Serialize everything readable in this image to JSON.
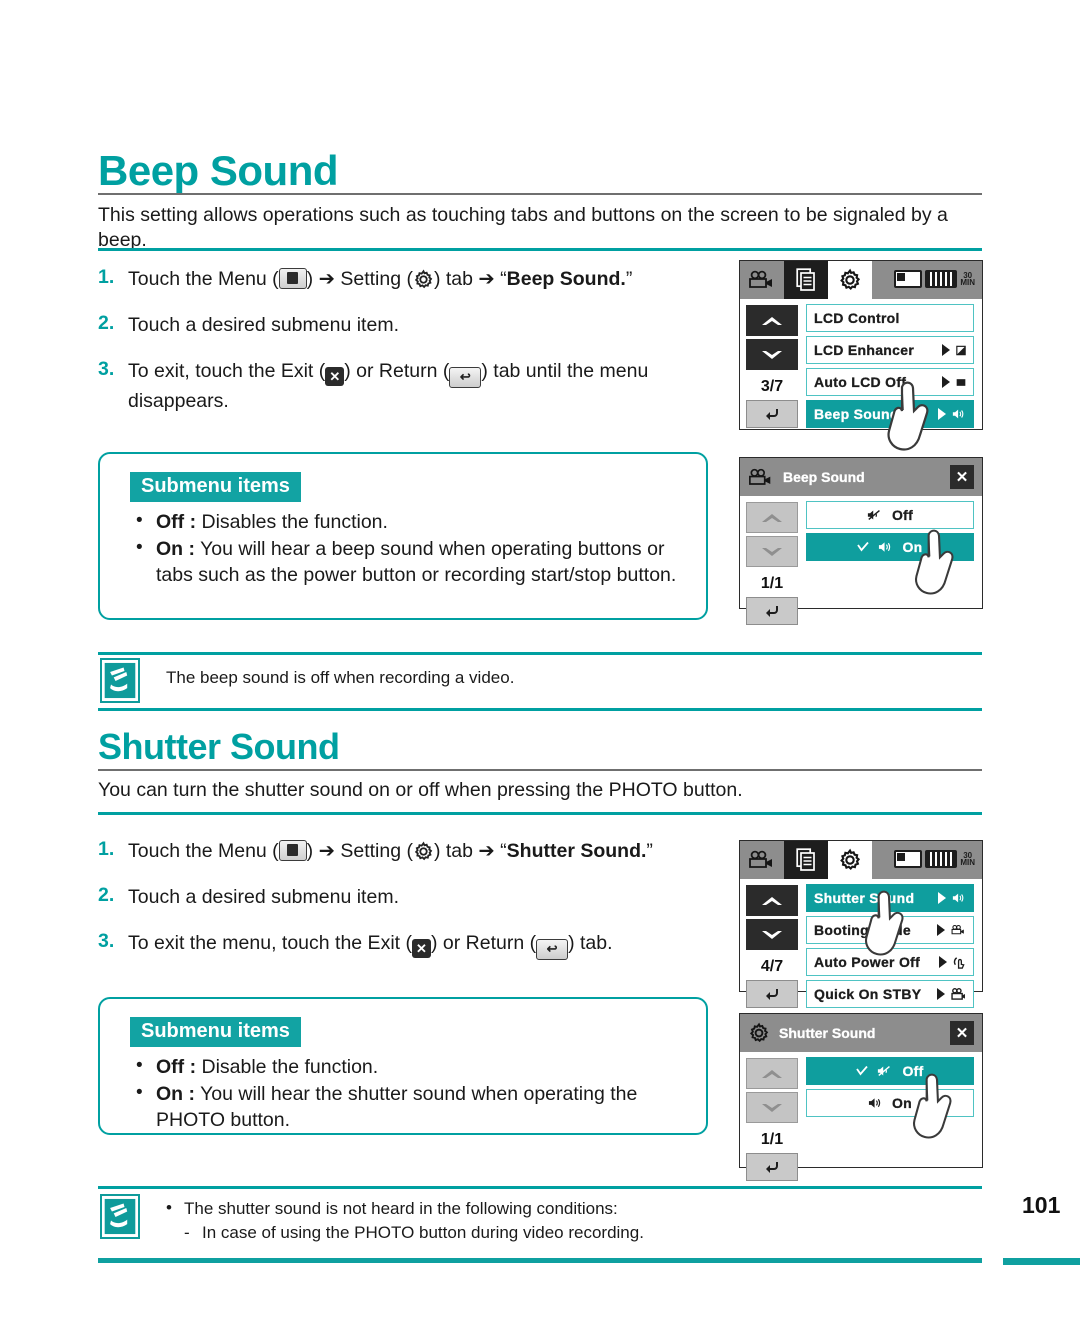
{
  "page": {
    "number": "101"
  },
  "sections": [
    {
      "id": "beep",
      "title": "Beep Sound",
      "description": "This setting allows operations such as touching tabs and buttons on the screen to be signaled by a beep.",
      "steps": [
        {
          "num": "1.",
          "pre": "Touch the Menu (",
          "mid": ") ➔ Setting (",
          "mid2": ") tab ➔ “",
          "bold": "Beep Sound.",
          "post": "”"
        },
        {
          "num": "2.",
          "text": "Touch a desired submenu item."
        },
        {
          "num": "3.",
          "pre": "To exit, touch the Exit (",
          "mid": ") or Return (",
          "post": ") tab until the menu disappears."
        }
      ],
      "submenu": {
        "heading": "Submenu items",
        "items": [
          {
            "label": "Off :",
            "text": "Disables the function."
          },
          {
            "label": "On :",
            "text": "You will hear a beep sound when operating buttons or tabs such as the power button or recording start/stop button."
          }
        ]
      },
      "note": {
        "text": "The beep sound is off when recording a video."
      }
    },
    {
      "id": "shutter",
      "title": "Shutter Sound",
      "description": "You can turn the shutter sound on or off when pressing the PHOTO button.",
      "steps": [
        {
          "num": "1.",
          "pre": "Touch the Menu (",
          "mid": ") ➔ Setting (",
          "mid2": ") tab ➔ “",
          "bold": "Shutter Sound.",
          "post": "”"
        },
        {
          "num": "2.",
          "text": "Touch a desired submenu item."
        },
        {
          "num": "3.",
          "pre": "To exit the menu, touch the Exit (",
          "mid": ") or Return (",
          "post": ") tab."
        }
      ],
      "submenu": {
        "heading": "Submenu items",
        "items": [
          {
            "label": "Off :",
            "text": "Disable the function."
          },
          {
            "label": "On :",
            "text": "You will hear the shutter sound when operating the PHOTO button."
          }
        ]
      },
      "note": {
        "bullet": "The shutter sound is not heard in the following conditions:",
        "dash": "In case of using the PHOTO button during video recording."
      }
    }
  ],
  "lcd_panels": [
    {
      "id": "beep-menu",
      "type": "menu",
      "tabs": [
        "camcorder-icon",
        "document-icon",
        "gear-icon"
      ],
      "active_tab": "gear-icon",
      "status": [
        "battery-icon",
        "battery-level-icon",
        "min-icon"
      ],
      "page_indicator": "3/7",
      "rows": [
        {
          "label": "LCD Control",
          "selected": false,
          "arrow": false,
          "icon": ""
        },
        {
          "label": "LCD Enhancer",
          "selected": false,
          "arrow": true,
          "icon": "contrast-icon"
        },
        {
          "label": "Auto LCD Off",
          "selected": false,
          "arrow": true,
          "icon": "screen-off-icon"
        },
        {
          "label": "Beep Sound",
          "selected": true,
          "arrow": true,
          "icon": "speaker-icon"
        }
      ],
      "nav": {
        "up": "chevron-up-icon",
        "down": "chevron-down-icon",
        "return": "return-icon"
      },
      "hand": true
    },
    {
      "id": "beep-submenu",
      "type": "submenu",
      "title": "Beep Sound",
      "title_icon": "camcorder-icon",
      "close": "close-icon",
      "page_indicator": "1/1",
      "rows": [
        {
          "label": "Off",
          "selected": false,
          "check": false,
          "icon": "speaker-mute-icon"
        },
        {
          "label": "On",
          "selected": true,
          "check": true,
          "icon": "speaker-icon"
        }
      ],
      "nav": {
        "up": "chevron-up-icon",
        "down": "chevron-down-icon",
        "return": "return-icon"
      },
      "hand": true
    },
    {
      "id": "shutter-menu",
      "type": "menu",
      "tabs": [
        "camcorder-icon",
        "document-icon",
        "gear-icon"
      ],
      "active_tab": "gear-icon",
      "status": [
        "battery-icon",
        "battery-level-icon",
        "min-icon"
      ],
      "page_indicator": "4/7",
      "rows": [
        {
          "label": "Shutter Sound",
          "selected": true,
          "arrow": true,
          "icon": "speaker-icon"
        },
        {
          "label": "Booting Mode",
          "selected": false,
          "arrow": true,
          "icon": "camcorder-icon"
        },
        {
          "label": "Auto Power Off",
          "selected": false,
          "arrow": true,
          "icon": "power-hand-icon"
        },
        {
          "label": "Quick On STBY",
          "selected": false,
          "arrow": true,
          "icon": "quick-on-icon"
        }
      ],
      "nav": {
        "up": "chevron-up-icon",
        "down": "chevron-down-icon",
        "return": "return-icon"
      },
      "hand": true
    },
    {
      "id": "shutter-submenu",
      "type": "submenu",
      "title": "Shutter Sound",
      "title_icon": "gear-icon",
      "close": "close-icon",
      "page_indicator": "1/1",
      "rows": [
        {
          "label": "Off",
          "selected": true,
          "check": true,
          "icon": "speaker-mute-icon"
        },
        {
          "label": "On",
          "selected": false,
          "check": false,
          "icon": "speaker-icon"
        }
      ],
      "nav": {
        "up": "chevron-up-icon",
        "down": "chevron-down-icon",
        "return": "return-icon"
      },
      "hand": true
    }
  ],
  "colors": {
    "accent": "#00A0A1",
    "selected_row": "#0F9E9E",
    "row_border": "#4FC3C3",
    "topbar": "#8D8D8D"
  }
}
